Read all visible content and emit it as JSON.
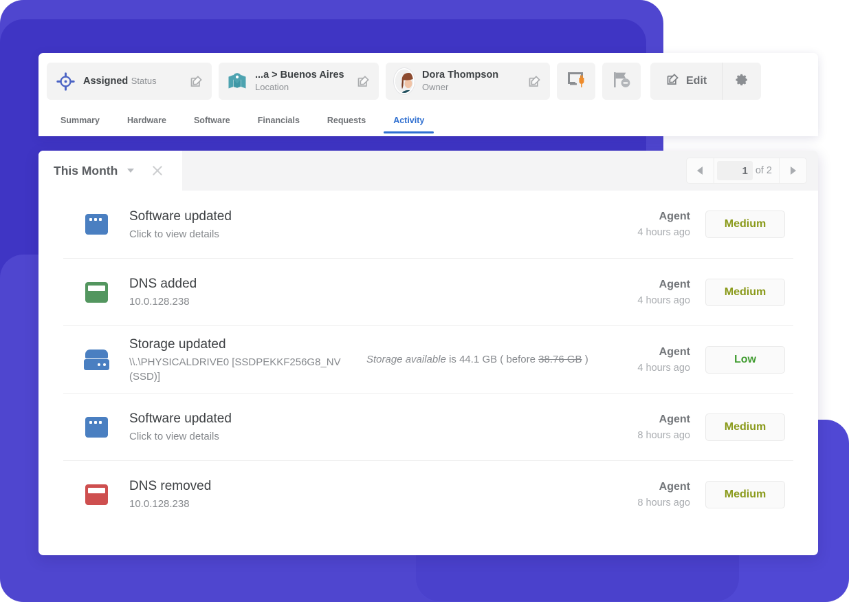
{
  "colors": {
    "bg_purple": "#4f46cf",
    "bg_purple_dark": "#3f35c4",
    "tab_active": "#2f6fd0",
    "badge_medium": "#8a9a1b",
    "badge_low": "#3f9b2f"
  },
  "toolbar": {
    "status_chip": {
      "title": "Assigned",
      "subtitle": "Status",
      "icon": "target-icon"
    },
    "location_chip": {
      "title": "...a > Buenos Aires",
      "subtitle": "Location",
      "icon": "map-pin-icon"
    },
    "owner_chip": {
      "title": "Dora Thompson",
      "subtitle": "Owner",
      "icon": "avatar"
    },
    "remote_button_icon": "monitor-plug-icon",
    "flag_button_icon": "flag-minus-icon",
    "edit_label": "Edit",
    "edit_icon": "pencil-square-icon",
    "settings_icon": "gear-icon"
  },
  "tabs": [
    {
      "label": "Summary",
      "active": false
    },
    {
      "label": "Hardware",
      "active": false
    },
    {
      "label": "Software",
      "active": false
    },
    {
      "label": "Financials",
      "active": false
    },
    {
      "label": "Requests",
      "active": false
    },
    {
      "label": "Activity",
      "active": true
    }
  ],
  "panel": {
    "filter": {
      "label": "This Month",
      "caret_icon": "chevron-down-icon",
      "clear_icon": "close-icon"
    },
    "pager": {
      "prev_icon": "chevron-left-icon",
      "next_icon": "chevron-right-icon",
      "current_page": "1",
      "of_text": "of 2"
    }
  },
  "activity_rows": [
    {
      "icon": "software-window-icon",
      "icon_style": "blue-dots",
      "title": "Software updated",
      "subtitle": "Click to view details",
      "detail_prefix": "",
      "detail_value": "",
      "detail_before_label": "",
      "detail_before_value": "",
      "detail_suffix": "",
      "actor": "Agent",
      "time": "4 hours ago",
      "priority": "Medium",
      "priority_level": "medium"
    },
    {
      "icon": "dns-added-icon",
      "icon_style": "green-bar",
      "title": "DNS added",
      "subtitle": "10.0.128.238",
      "detail_prefix": "",
      "detail_value": "",
      "detail_before_label": "",
      "detail_before_value": "",
      "detail_suffix": "",
      "actor": "Agent",
      "time": "4 hours ago",
      "priority": "Medium",
      "priority_level": "medium"
    },
    {
      "icon": "hard-drive-icon",
      "icon_style": "hdd",
      "title": "Storage updated",
      "subtitle": "\\\\.\\PHYSICALDRIVE0 [SSDPEKKF256G8_NV (SSD)]",
      "detail_prefix": "Storage available",
      "detail_value": " is 44.1 GB ( before ",
      "detail_before_label": "",
      "detail_before_value": "38.76 GB",
      "detail_suffix": " )",
      "actor": "Agent",
      "time": "4 hours ago",
      "priority": "Low",
      "priority_level": "low"
    },
    {
      "icon": "software-window-icon",
      "icon_style": "blue-dots",
      "title": "Software updated",
      "subtitle": "Click to view details",
      "detail_prefix": "",
      "detail_value": "",
      "detail_before_label": "",
      "detail_before_value": "",
      "detail_suffix": "",
      "actor": "Agent",
      "time": "8 hours ago",
      "priority": "Medium",
      "priority_level": "medium"
    },
    {
      "icon": "dns-removed-icon",
      "icon_style": "red-bar",
      "title": "DNS removed",
      "subtitle": "10.0.128.238",
      "detail_prefix": "",
      "detail_value": "",
      "detail_before_label": "",
      "detail_before_value": "",
      "detail_suffix": "",
      "actor": "Agent",
      "time": "8 hours ago",
      "priority": "Medium",
      "priority_level": "medium"
    }
  ]
}
